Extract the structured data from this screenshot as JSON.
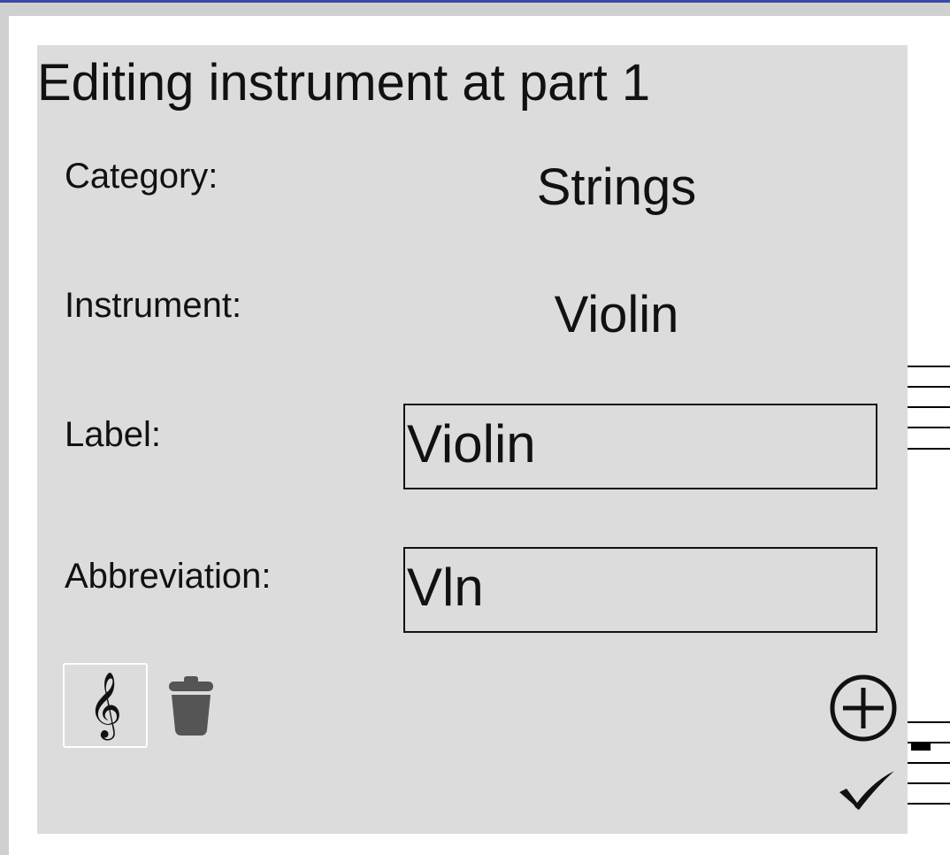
{
  "dialog": {
    "title": "Editing instrument at part 1",
    "category": {
      "label": "Category:",
      "value": "Strings"
    },
    "instrument": {
      "label": "Instrument:",
      "value": "Violin"
    },
    "label_field": {
      "label": "Label:",
      "value": "Violin"
    },
    "abbreviation_field": {
      "label": "Abbreviation:",
      "value": "Vln"
    },
    "buttons": {
      "clef": {
        "glyph": "𝄞",
        "icon": "treble-clef-icon"
      },
      "delete": {
        "icon": "trash-icon"
      },
      "add": {
        "icon": "plus-circle-icon"
      },
      "confirm": {
        "icon": "check-icon"
      }
    }
  },
  "colors": {
    "dialog_background": "#dcdcdc",
    "top_border": "#3a4aa8",
    "chrome": "#d0d0d0",
    "icon_gray": "#555555",
    "text": "#111111"
  }
}
